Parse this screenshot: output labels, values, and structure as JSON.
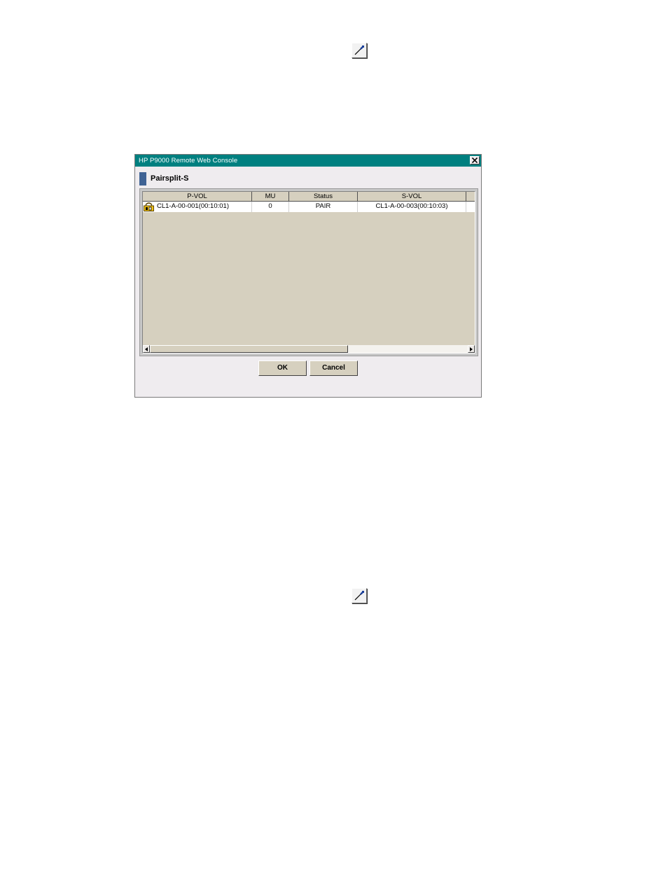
{
  "toolbar_icons": [
    {
      "name": "pipette-icon"
    },
    {
      "name": "pipette-icon"
    }
  ],
  "window": {
    "title": "HP P9000 Remote Web Console",
    "close_icon": "close-icon"
  },
  "dialog": {
    "heading": "Pairsplit-S",
    "table": {
      "columns": [
        "P-VOL",
        "MU",
        "Status",
        "S-VOL"
      ],
      "rows": [
        {
          "pvol": "CL1-A-00-001(00:10:01)",
          "mu": "0",
          "status": "PAIR",
          "svol": "CL1-A-00-003(00:10:03)",
          "icon": "lock-volume-icon"
        }
      ]
    },
    "buttons": {
      "ok": "OK",
      "cancel": "Cancel"
    }
  }
}
